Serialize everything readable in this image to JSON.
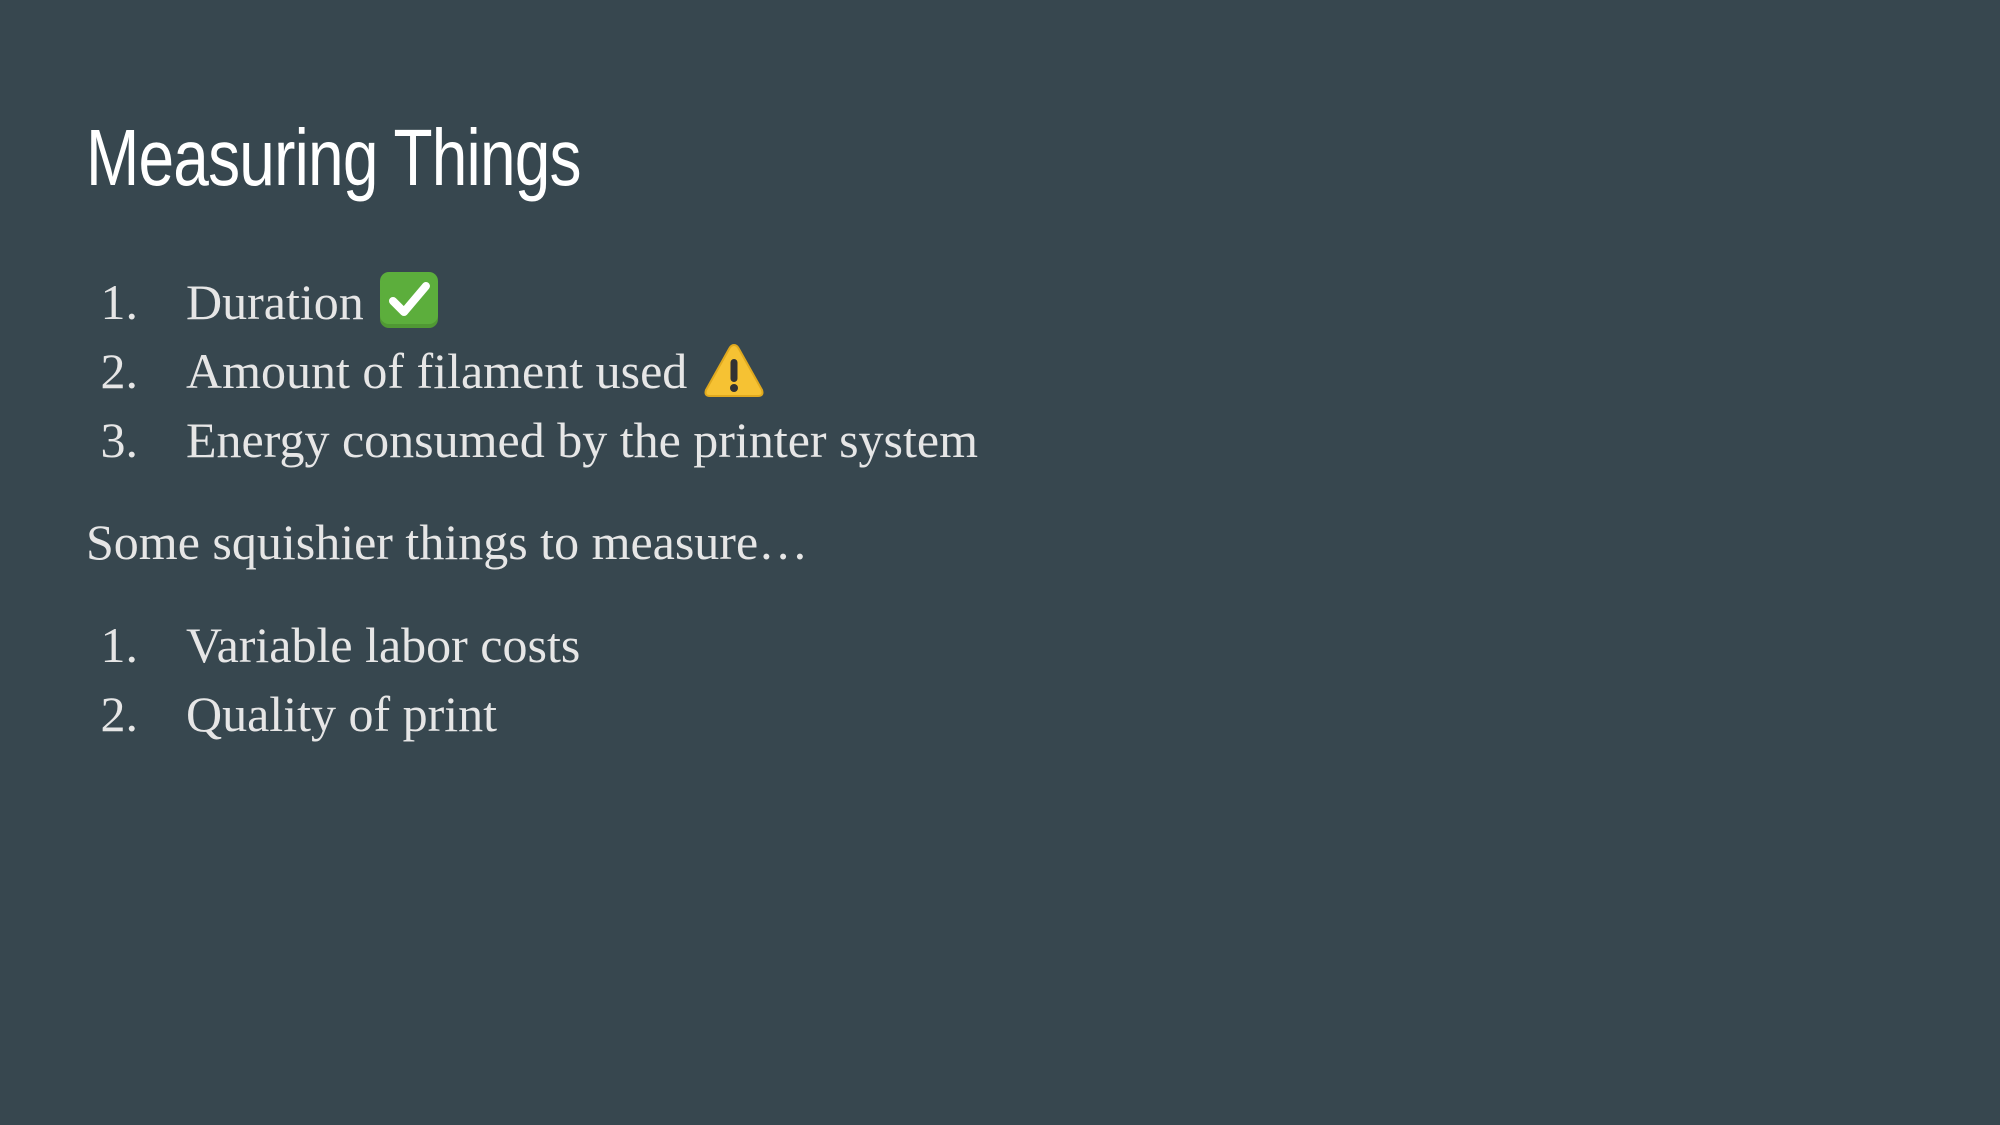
{
  "slide": {
    "title": "Measuring Things",
    "list_primary": [
      {
        "number": "1.",
        "text": "Duration",
        "icon": "check-mark-button-icon"
      },
      {
        "number": "2.",
        "text": "Amount of filament used",
        "icon": "warning-icon"
      },
      {
        "number": "3.",
        "text": "Energy consumed by the printer system"
      }
    ],
    "paragraph": "Some squishier things to measure…",
    "list_secondary": [
      {
        "number": "1.",
        "text": "Variable labor costs"
      },
      {
        "number": "2.",
        "text": "Quality of print"
      }
    ]
  },
  "colors": {
    "background": "#37474f",
    "title": "#ffffff",
    "body_text": "#e6e6e6",
    "check_icon": "#5cae3c",
    "warning_icon": "#f6c233"
  }
}
